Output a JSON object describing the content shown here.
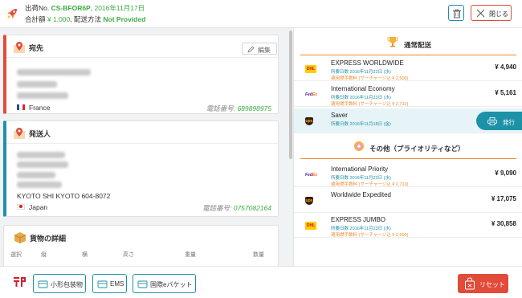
{
  "header": {
    "shipment_label": "出荷No.",
    "shipment_no": "CS-BFOR6P",
    "shipment_date": "2016年11月17日",
    "total_label": "合計額",
    "total_amount": "¥ 1,000",
    "method_label": "配送方法",
    "method_value": "Not Provided",
    "close_label": "閉じる"
  },
  "recipient": {
    "title": "宛先",
    "edit_label": "編集",
    "country": "France",
    "phone_label": "電話番号:",
    "phone": "689898975"
  },
  "sender": {
    "title": "発送人",
    "city_line": "KYOTO SHI KYOTO 604-8072",
    "country": "Japan",
    "phone_label": "電話番号:",
    "phone": "0757082164"
  },
  "cargo": {
    "title": "貨物の詳細",
    "columns": [
      "選択",
      "縦",
      "横",
      "高さ",
      "重量",
      "数量"
    ]
  },
  "rates": {
    "standard_title": "通常配送",
    "other_title": "その他（プライオリティなど）",
    "issue_label": "発行",
    "standard": [
      {
        "name": "EXPRESS WORLDWIDE",
        "days": "所要日数 2016年11月23日 (水)",
        "fee": "適用燃手数料 (サーチャージ込 ¥ 2,500)",
        "price": "¥ 4,940",
        "carrier": "DHL"
      },
      {
        "name": "International Economy",
        "days": "所要日数 2016年11月23日 (水)",
        "fee": "適用燃手数料 (サーチャージ込 ¥ 2,710)",
        "price": "¥ 5,161",
        "carrier": "FedEx"
      },
      {
        "name": "Saver",
        "days": "所要日数 2016年11月18日 (金)",
        "fee": "",
        "price": "",
        "carrier": "UPS"
      }
    ],
    "other": [
      {
        "name": "International Priority",
        "days": "所要日数 2016年11月23日 (水)",
        "fee": "適用燃手数料 (サーチャージ込 ¥ 2,710)",
        "price": "¥ 9,090",
        "carrier": "FedEx"
      },
      {
        "name": "Worldwide Expedited",
        "days": "",
        "fee": "",
        "price": "¥ 17,075",
        "carrier": "UPS"
      },
      {
        "name": "EXPRESS JUMBO",
        "days": "所要日数 2016年11月23日 (水)",
        "fee": "適用燃手数料 (サーチャージ込 ¥ 2,500)",
        "price": "¥ 30,858",
        "carrier": "DHL"
      }
    ]
  },
  "logos": {
    "dhl": "DHL",
    "fedex_a": "Fed",
    "fedex_b": "Ex",
    "ups": "ups"
  },
  "footer": {
    "btn_small_packet": "小形包装物",
    "btn_ems": "EMS",
    "btn_intl_epacket": "国際eパケット",
    "reset_label": "リセット"
  },
  "colors": {
    "accent_teal": "#1d91a8",
    "accent_red": "#e24b3a",
    "accent_orange": "#f08a2c",
    "green": "#3cab42"
  }
}
